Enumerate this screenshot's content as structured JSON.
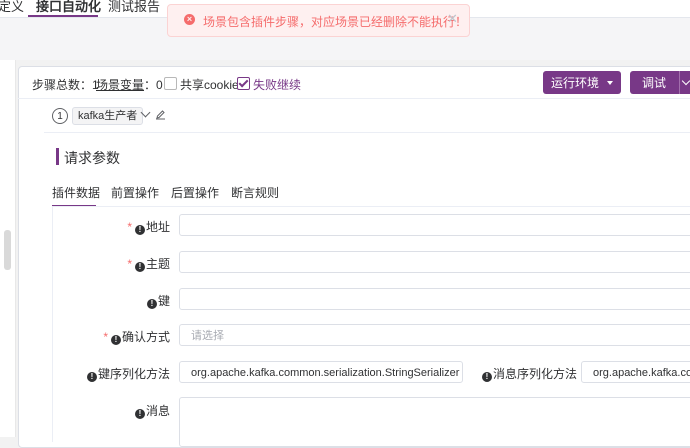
{
  "top_tabs": [
    {
      "label": "定义"
    },
    {
      "label": "接口自动化"
    },
    {
      "label": "测试报告"
    }
  ],
  "toast": {
    "message": "场景包含插件步骤，对应场景已经删除不能执行！",
    "icon": "error-circle-icon",
    "close_icon": "close-icon",
    "color": "#f56c6c"
  },
  "toolbar": {
    "step_total_label": "步骤总数：",
    "step_total_value": "1",
    "scene_var_label": "场景变量",
    "scene_var_sep": "：",
    "scene_var_value": "0",
    "share_cookie_label": "共享cookie",
    "share_cookie_checked": false,
    "continue_on_fail_label": "失败继续",
    "continue_on_fail_checked": true,
    "run_env_label": "运行环境",
    "debug_label": "调试"
  },
  "step": {
    "index": "1",
    "name": "kafka生产者"
  },
  "section": {
    "title": "请求参数"
  },
  "sub_tabs": [
    {
      "label": "插件数据"
    },
    {
      "label": "前置操作"
    },
    {
      "label": "后置操作"
    },
    {
      "label": "断言规则"
    }
  ],
  "form": {
    "address_label": "地址",
    "topic_label": "主题",
    "key_label": "键",
    "ack_label": "确认方式",
    "ack_placeholder": "请选择",
    "key_serializer_label": "键序列化方法",
    "key_serializer_value": "org.apache.kafka.common.serialization.StringSerializer",
    "value_serializer_label": "消息序列化方法",
    "value_serializer_value": "org.apache.kafka.common.serialization.StringSerializer",
    "message_label": "消息"
  },
  "colors": {
    "accent": "#783887",
    "error": "#f56c6c",
    "required": "#f56c6c"
  }
}
